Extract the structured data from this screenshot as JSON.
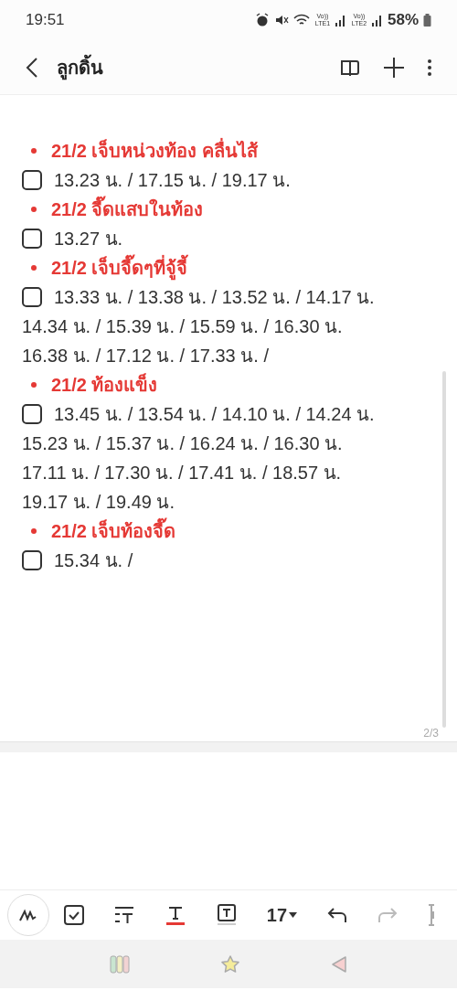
{
  "status_bar": {
    "time": "19:51",
    "sim_1": "Vo)) LTE1",
    "sim_2": "Vo)) LTE2",
    "battery": "58%"
  },
  "header": {
    "title": "ลูกดิ้น"
  },
  "note": [
    {
      "heading": "21/2 เจ็บหน่วงท้อง คลื่นไส้",
      "checked": false,
      "lines": [
        "13.23 น. / 17.15 น. / 19.17 น."
      ]
    },
    {
      "heading": "21/2 จี๊ดแสบในท้อง",
      "checked": false,
      "lines": [
        "13.27 น."
      ]
    },
    {
      "heading": "21/2 เจ็บจี๊ดๆที่จู้จี้",
      "checked": false,
      "lines": [
        "13.33 น. / 13.38 น. / 13.52 น. / 14.17 น.",
        "14.34 น. / 15.39 น. / 15.59 น. / 16.30 น.",
        "16.38 น. / 17.12 น. / 17.33 น. /"
      ]
    },
    {
      "heading": "21/2 ท้องแข็ง",
      "checked": false,
      "lines": [
        "13.45 น. / 13.54 น. / 14.10 น. / 14.24 น.",
        "15.23 น. / 15.37 น. / 16.24 น. / 16.30 น.",
        "17.11 น. / 17.30 น. / 17.41 น. / 18.57 น.",
        "19.17 น. / 19.49 น."
      ]
    },
    {
      "heading": "21/2 เจ็บท้องจี๊ด",
      "checked": false,
      "lines": [
        "15.34 น. /"
      ]
    }
  ],
  "page_indicator": "2/3",
  "toolbar": {
    "font_size": "17"
  }
}
